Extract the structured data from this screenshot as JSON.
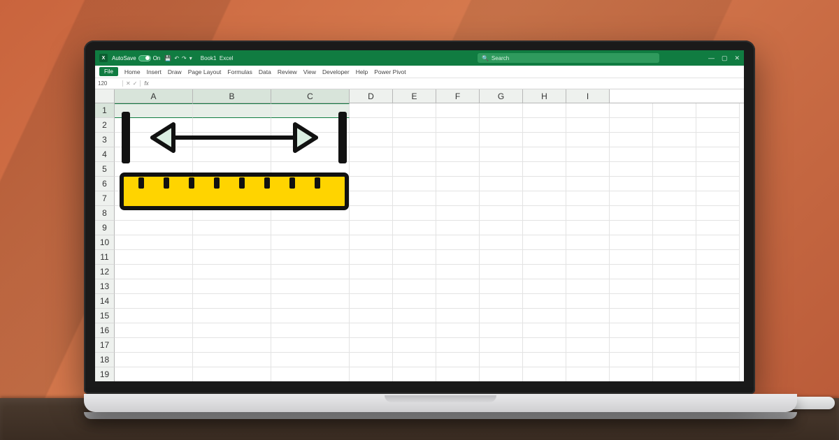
{
  "titlebar": {
    "app_icon": "X",
    "autosave_label": "AutoSave",
    "autosave_state": "On",
    "doc_name": "Book1",
    "doc_suffix": "Excel",
    "search_placeholder": "Search"
  },
  "ribbon": {
    "file": "File",
    "tabs": [
      "Home",
      "Insert",
      "Draw",
      "Page Layout",
      "Formulas",
      "Data",
      "Review",
      "View",
      "Developer",
      "Help",
      "Power Pivot"
    ]
  },
  "formula_bar": {
    "name_box": "120",
    "fx": "fx"
  },
  "columns": {
    "selected": [
      "A",
      "B",
      "C"
    ],
    "rest": [
      "D",
      "E",
      "F",
      "G",
      "H",
      "I"
    ]
  },
  "rows": {
    "count": 19,
    "selected": 1
  },
  "illustration": {
    "arrow_name": "horizontal-resize-arrow-icon",
    "ruler_name": "ruler-icon",
    "ruler_color": "#ffd400"
  }
}
